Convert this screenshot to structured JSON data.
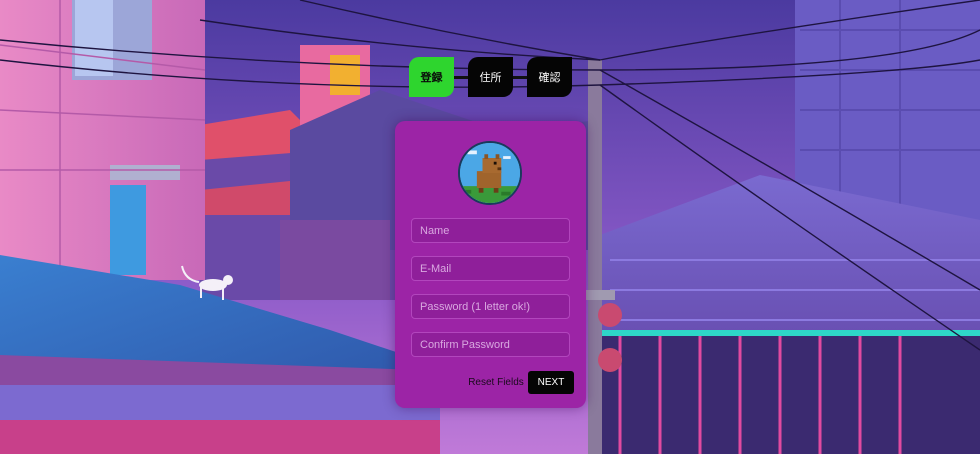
{
  "stepper": {
    "steps": [
      {
        "label": "登録",
        "active": true
      },
      {
        "label": "住所",
        "active": false
      },
      {
        "label": "確認",
        "active": false
      }
    ]
  },
  "form": {
    "avatar_icon": "capybara-avatar-icon",
    "fields": [
      {
        "placeholder": "Name",
        "value": ""
      },
      {
        "placeholder": "E-Mail",
        "value": ""
      },
      {
        "placeholder": "Password (1 letter ok!)",
        "value": ""
      },
      {
        "placeholder": "Confirm Password",
        "value": ""
      }
    ],
    "reset_label": "Reset Fields",
    "next_label": "NEXT"
  },
  "colors": {
    "active_step": "#2ed52e",
    "inactive_step": "#050505",
    "card": "#9c24a6",
    "next_button": "#050505"
  }
}
